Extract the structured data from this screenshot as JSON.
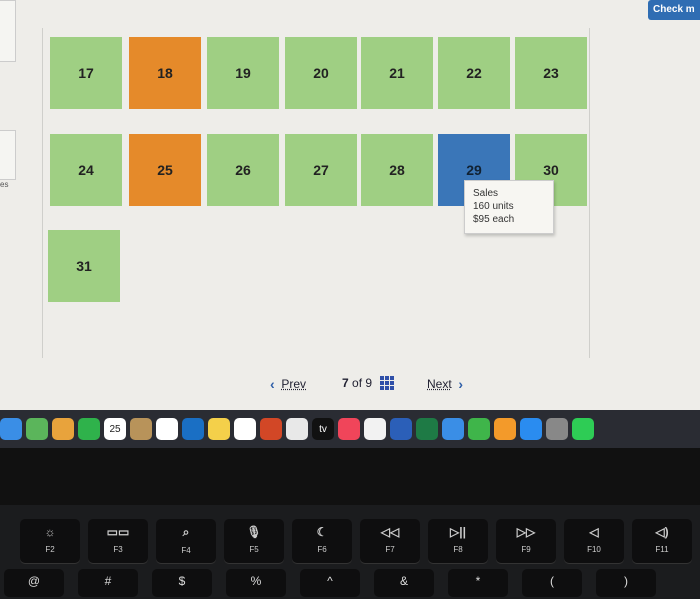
{
  "header": {
    "check_button": "Check m"
  },
  "calendar": {
    "rows": [
      [
        {
          "day": "17",
          "color": "green"
        },
        {
          "day": "18",
          "color": "orange"
        },
        {
          "day": "19",
          "color": "green"
        },
        {
          "day": "20",
          "color": "green"
        },
        {
          "day": "21",
          "color": "green"
        },
        {
          "day": "22",
          "color": "green"
        },
        {
          "day": "23",
          "color": "green"
        }
      ],
      [
        {
          "day": "24",
          "color": "green"
        },
        {
          "day": "25",
          "color": "orange"
        },
        {
          "day": "26",
          "color": "green"
        },
        {
          "day": "27",
          "color": "green"
        },
        {
          "day": "28",
          "color": "green"
        },
        {
          "day": "29",
          "color": "blue"
        },
        {
          "day": "30",
          "color": "green"
        }
      ],
      [
        {
          "day": "31",
          "color": "green"
        }
      ]
    ],
    "colors": {
      "green": "#9fcf83",
      "orange": "#e58a2a",
      "blue": "#3a76b8"
    }
  },
  "tooltip": {
    "line1": "Sales",
    "line2": "160 units",
    "line3": "$95 each"
  },
  "pager": {
    "prev": "Prev",
    "current": "7",
    "of": "of",
    "total": "9",
    "next": "Next"
  },
  "sidebar_fragment": "es",
  "dock": {
    "apps": [
      "mail",
      "maps",
      "photos",
      "facetime",
      "calendar",
      "contacts",
      "reminders",
      "outlook",
      "notes",
      "freeform",
      "powerpoint",
      "chrome",
      "tv",
      "music",
      "news",
      "word",
      "excel",
      "keynote",
      "numbers",
      "pages",
      "app-store",
      "settings",
      "whatsapp"
    ],
    "calendar_date": "25",
    "tv_label": "tv"
  },
  "keyboard": {
    "fkeys": [
      "F2",
      "F3",
      "F4",
      "F5",
      "F6",
      "F7",
      "F8",
      "F9",
      "F10",
      "F11"
    ],
    "fkey_icons": [
      "☼",
      "▭▭",
      "⌕",
      "🎙",
      "☾",
      "◁◁",
      "▷||",
      "▷▷",
      "◁",
      "◁)"
    ],
    "bottom": [
      "@",
      "#",
      "$",
      "%",
      "^",
      "&",
      "*",
      "(",
      ")"
    ]
  }
}
